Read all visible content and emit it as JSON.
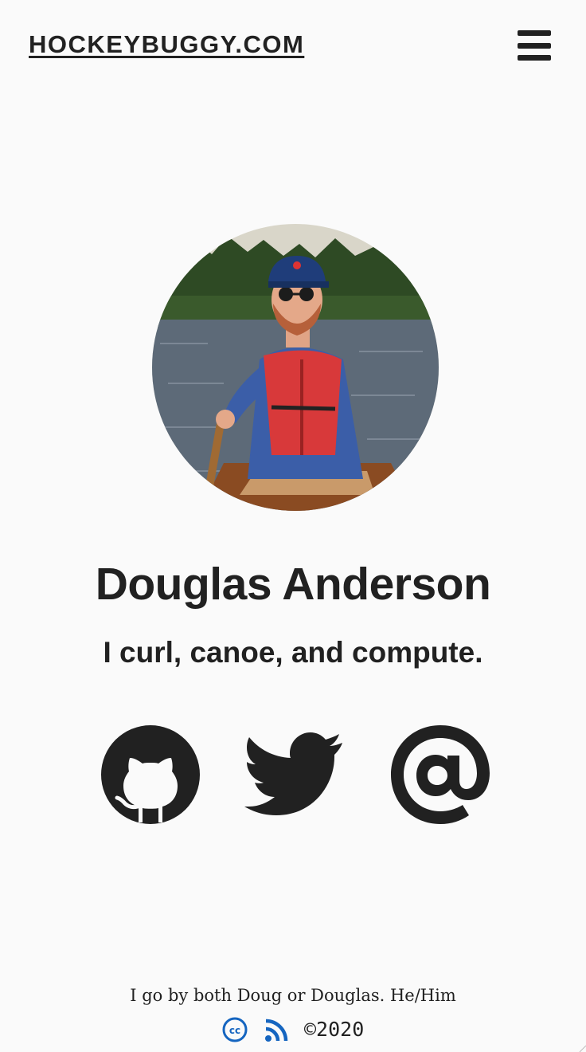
{
  "header": {
    "site_title": "HOCKEYBUGGY.COM",
    "menu_icon": "hamburger-menu-icon"
  },
  "profile": {
    "name": "Douglas Anderson",
    "tagline": "I curl, canoe, and compute.",
    "photo_description_icon": "profile-photo"
  },
  "social": [
    {
      "icon": "github-icon",
      "color": "#212121"
    },
    {
      "icon": "twitter-icon",
      "color": "#212121"
    },
    {
      "icon": "email-at-icon",
      "color": "#212121"
    }
  ],
  "footer": {
    "note": "I go by both Doug or Douglas. He/Him",
    "cc_icon": "creative-commons-icon",
    "rss_icon": "rss-feed-icon",
    "copyright": "©2020",
    "link_color": "#1565c0"
  },
  "colors": {
    "background": "#fafafa",
    "text": "#212121",
    "accent": "#1565c0"
  }
}
